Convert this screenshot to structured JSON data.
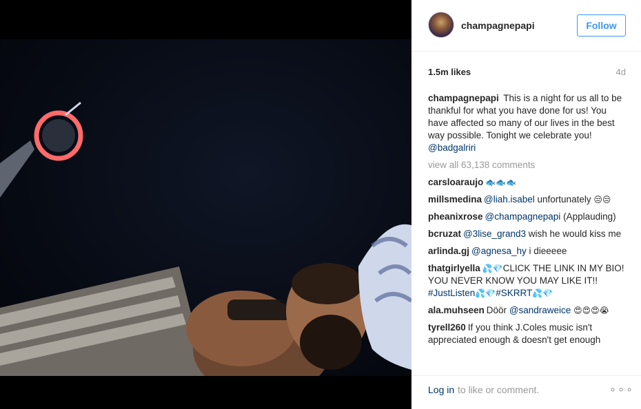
{
  "header": {
    "username": "champagnepapi",
    "follow_label": "Follow"
  },
  "stats": {
    "likes": "1.5m likes",
    "age": "4d"
  },
  "caption": {
    "username": "champagnepapi",
    "text": "This is a night for us all to be thankful for what you have done for us! You have affected so many of our lives in the best way possible. Tonight we celebrate you!",
    "mention": "@badgalriri"
  },
  "view_all": "view all 63,138 comments",
  "comments": [
    {
      "user": "carsloaraujo",
      "parts": [
        {
          "t": "🐟🐟🐟",
          "type": "emoji"
        }
      ]
    },
    {
      "user": "millsmedina",
      "parts": [
        {
          "t": "@liah.isabel",
          "type": "mention"
        },
        {
          "t": " unfortunately ",
          "type": "text"
        },
        {
          "t": "😒😒",
          "type": "emoji"
        }
      ]
    },
    {
      "user": "pheanixrose",
      "parts": [
        {
          "t": "@champagnepapi",
          "type": "mention"
        },
        {
          "t": " (Applauding)",
          "type": "text"
        }
      ]
    },
    {
      "user": "bcruzat",
      "parts": [
        {
          "t": "@3lise_grand3",
          "type": "mention"
        },
        {
          "t": " wish he would kiss me",
          "type": "text"
        }
      ]
    },
    {
      "user": "arlinda.gj",
      "parts": [
        {
          "t": "@agnesa_hy",
          "type": "mention"
        },
        {
          "t": " i dieeeee",
          "type": "text"
        }
      ]
    },
    {
      "user": "thatgirlyella",
      "parts": [
        {
          "t": "💦💎",
          "type": "emoji"
        },
        {
          "t": "CLICK THE LINK IN MY BIO! YOU NEVER KNOW YOU MAY LIKE IT!! ",
          "type": "text"
        },
        {
          "t": "#JustListen",
          "type": "mention"
        },
        {
          "t": "💦💎",
          "type": "emoji"
        },
        {
          "t": "#SKRRT",
          "type": "mention"
        },
        {
          "t": "💦💎",
          "type": "emoji"
        }
      ]
    },
    {
      "user": "ala.muhseen",
      "parts": [
        {
          "t": "Döör ",
          "type": "text"
        },
        {
          "t": "@sandraweice",
          "type": "mention"
        },
        {
          "t": " 😍😍😍😭",
          "type": "emoji"
        }
      ]
    },
    {
      "user": "tyrell260",
      "parts": [
        {
          "t": "If you think J.Coles music isn't appreciated enough & doesn't get enough",
          "type": "text"
        }
      ]
    }
  ],
  "footer": {
    "login_label": "Log in",
    "login_rest": "to like or comment.",
    "more_label": "ooo"
  }
}
